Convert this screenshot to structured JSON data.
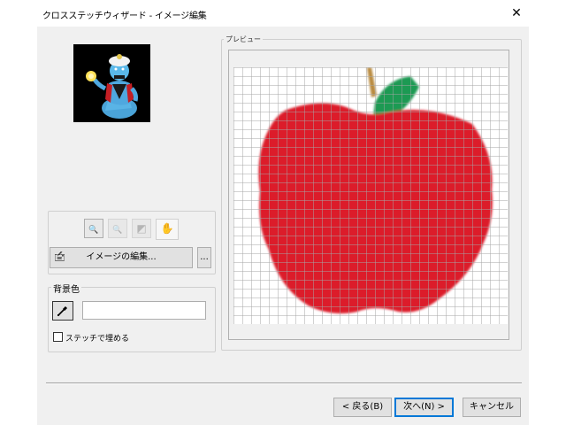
{
  "window": {
    "title": "クロスステッチウィザード - イメージ編集",
    "close_symbol": "✕"
  },
  "preview": {
    "label": "プレビュー",
    "grid_color": "#a6a6a6",
    "apple_color": "#dc1e2b",
    "leaf_color": "#1e9a52",
    "stem_color": "#b8893e"
  },
  "image_tools": {
    "zoom_in_symbol": "🔍",
    "zoom_out_symbol": "🔍",
    "fit_symbol": "◩",
    "pan_symbol": "✋",
    "edit_button_label": "イメージの編集...",
    "more_button_label": "..."
  },
  "background": {
    "label": "背景色",
    "color_value": "",
    "fill_checkbox_label": "ステッチで埋める",
    "fill_checked": false
  },
  "footer": {
    "back_label": "< 戻る(B)",
    "next_label": "次へ(N) >",
    "cancel_label": "キャンセル"
  }
}
